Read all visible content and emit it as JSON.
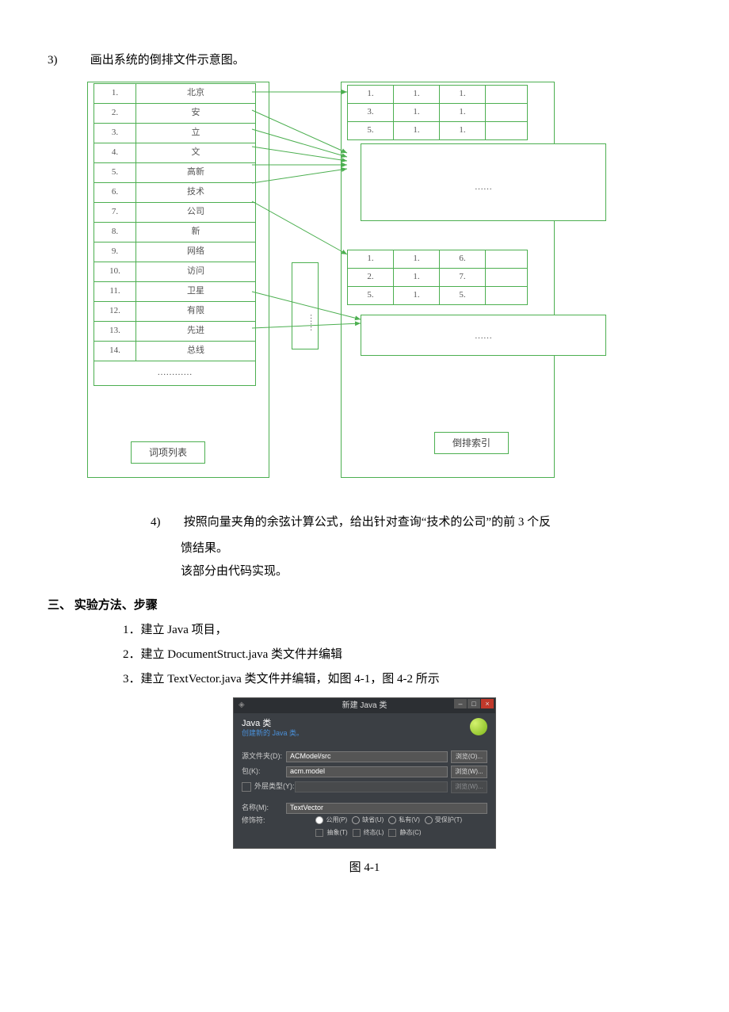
{
  "q3": {
    "num": "3)",
    "text": "画出系统的倒排文件示意图。"
  },
  "diagram": {
    "terms": [
      {
        "idx": "1.",
        "w": "北京"
      },
      {
        "idx": "2.",
        "w": "安"
      },
      {
        "idx": "3.",
        "w": "立"
      },
      {
        "idx": "4.",
        "w": "文"
      },
      {
        "idx": "5.",
        "w": "高新"
      },
      {
        "idx": "6.",
        "w": "技术"
      },
      {
        "idx": "7.",
        "w": "公司"
      },
      {
        "idx": "8.",
        "w": "新"
      },
      {
        "idx": "9.",
        "w": "网络"
      },
      {
        "idx": "10.",
        "w": "访问"
      },
      {
        "idx": "11.",
        "w": "卫星"
      },
      {
        "idx": "12.",
        "w": "有限"
      },
      {
        "idx": "13.",
        "w": "先进"
      },
      {
        "idx": "14.",
        "w": "总线"
      }
    ],
    "term_ellipsis": "…………",
    "term_label": "词项列表",
    "mid": "……",
    "postings_top": [
      [
        "1.",
        "1.",
        "1."
      ],
      [
        "3.",
        "1.",
        "1."
      ],
      [
        "5.",
        "1.",
        "1."
      ]
    ],
    "big_dots": "……",
    "postings_mid": [
      [
        "1.",
        "1.",
        "6."
      ],
      [
        "2.",
        "1.",
        "7."
      ],
      [
        "5.",
        "1.",
        "5."
      ]
    ],
    "big_dots2": "……",
    "inv_label": "倒排索引"
  },
  "q4": {
    "num": "4)",
    "text_a": "按照向量夹角的余弦计算公式，给出针对查询“技术的公司”的前 3 个反",
    "text_b": "馈结果。",
    "text_c": "该部分由代码实现。"
  },
  "sec3": {
    "heading": "三、  实验方法、步骤",
    "s1": "1．建立 Java 项目，",
    "s2": "2．建立 DocumentStruct.java 类文件并编辑",
    "s3": "3．建立 TextVector.java 类文件并编辑，如图 4-1，图 4-2 所示"
  },
  "dialog": {
    "title": "新建 Java 类",
    "winbtns": {
      "min": "–",
      "max": "□",
      "close": "×"
    },
    "head_title": "Java 类",
    "head_sub": "创建新的 Java 类。",
    "rows": {
      "srcfolder_lbl": "源文件夹(D):",
      "srcfolder_val": "ACModel/src",
      "browse1": "浏览(O)...",
      "pkg_lbl": "包(K):",
      "pkg_val": "acm.model",
      "browse2": "浏览(W)...",
      "enclose_chk": "外层类型(Y):",
      "browse3": "浏览(W)...",
      "name_lbl": "名称(M):",
      "name_val": "TextVector",
      "mod_lbl": "修饰符:",
      "mods": [
        "公用(P)",
        "缺省(U)",
        "私有(V)",
        "受保护(T)",
        "抽象(T)",
        "终态(L)",
        "静态(C)"
      ]
    }
  },
  "fig_caption": "图 4-1"
}
